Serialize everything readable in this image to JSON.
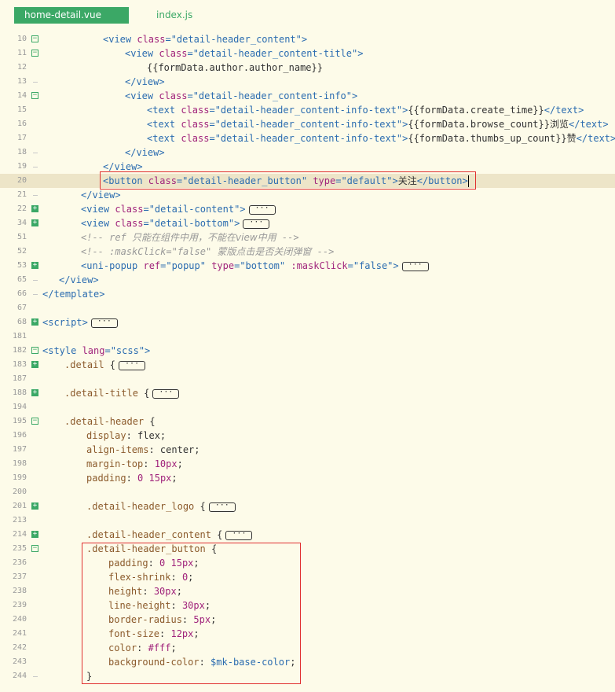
{
  "tabs": [
    {
      "label": "home-detail.vue",
      "active": true
    },
    {
      "label": "index.js",
      "active": false
    }
  ],
  "colors": {
    "accent": "#3ba866",
    "highlight_box": "#e03030",
    "background": "#fdfbe9"
  },
  "lines": [
    {
      "n": "10",
      "fold": "minus",
      "indent": 11,
      "tokens": [
        [
          "tag",
          "<view "
        ],
        [
          "attr",
          "class"
        ],
        [
          "tag",
          "=\"detail-header_content\">"
        ]
      ]
    },
    {
      "n": "11",
      "fold": "minus",
      "indent": 15,
      "tokens": [
        [
          "tag",
          "<view "
        ],
        [
          "attr",
          "class"
        ],
        [
          "tag",
          "=\"detail-header_content-title\">"
        ]
      ]
    },
    {
      "n": "12",
      "fold": "",
      "indent": 19,
      "tokens": [
        [
          "txt",
          "{{formData.author.author_name}}"
        ]
      ]
    },
    {
      "n": "13",
      "fold": "end",
      "indent": 15,
      "tokens": [
        [
          "tag",
          "</view>"
        ]
      ]
    },
    {
      "n": "14",
      "fold": "minus",
      "indent": 15,
      "tokens": [
        [
          "tag",
          "<view "
        ],
        [
          "attr",
          "class"
        ],
        [
          "tag",
          "=\"detail-header_content-info\">"
        ]
      ]
    },
    {
      "n": "15",
      "fold": "",
      "indent": 19,
      "tokens": [
        [
          "tag",
          "<text "
        ],
        [
          "attr",
          "class"
        ],
        [
          "tag",
          "=\"detail-header_content-info-text\">"
        ],
        [
          "txt",
          "{{formData.create_time}}"
        ],
        [
          "tag",
          "</text>"
        ]
      ]
    },
    {
      "n": "16",
      "fold": "",
      "indent": 19,
      "tokens": [
        [
          "tag",
          "<text "
        ],
        [
          "attr",
          "class"
        ],
        [
          "tag",
          "=\"detail-header_content-info-text\">"
        ],
        [
          "txt",
          "{{formData.browse_count}}"
        ],
        [
          "cjk",
          "浏览"
        ],
        [
          "tag",
          "</text>"
        ]
      ]
    },
    {
      "n": "17",
      "fold": "",
      "indent": 19,
      "tokens": [
        [
          "tag",
          "<text "
        ],
        [
          "attr",
          "class"
        ],
        [
          "tag",
          "=\"detail-header_content-info-text\">"
        ],
        [
          "txt",
          "{{formData.thumbs_up_count}}"
        ],
        [
          "cjk",
          "赞"
        ],
        [
          "tag",
          "</text>"
        ]
      ]
    },
    {
      "n": "18",
      "fold": "end",
      "indent": 15,
      "tokens": [
        [
          "tag",
          "</view>"
        ]
      ]
    },
    {
      "n": "19",
      "fold": "end",
      "indent": 11,
      "tokens": [
        [
          "tag",
          "</view>"
        ]
      ]
    },
    {
      "n": "20",
      "fold": "",
      "indent": 11,
      "hl": true,
      "cursor": true,
      "tokens": [
        [
          "tag",
          "<button "
        ],
        [
          "attr",
          "class"
        ],
        [
          "tag",
          "=\"detail-header_button\" "
        ],
        [
          "attr",
          "type"
        ],
        [
          "tag",
          "=\"default\">"
        ],
        [
          "cjk",
          "关注"
        ],
        [
          "tag",
          "</button>"
        ]
      ]
    },
    {
      "n": "21",
      "fold": "end",
      "indent": 7,
      "tokens": [
        [
          "tag",
          "</view>"
        ]
      ]
    },
    {
      "n": "22",
      "fold": "plus",
      "indent": 7,
      "ellip": true,
      "tokens": [
        [
          "tag",
          "<view "
        ],
        [
          "attr",
          "class"
        ],
        [
          "tag",
          "=\"detail-content\">"
        ]
      ]
    },
    {
      "n": "34",
      "fold": "plus",
      "indent": 7,
      "ellip": true,
      "tokens": [
        [
          "tag",
          "<view "
        ],
        [
          "attr",
          "class"
        ],
        [
          "tag",
          "=\"detail-bottom\">"
        ]
      ]
    },
    {
      "n": "51",
      "fold": "",
      "indent": 7,
      "tokens": [
        [
          "cm",
          "<!-- ref "
        ],
        [
          "cmcjk",
          "只能在组件中用，不能在view中用"
        ],
        [
          "cm",
          " -->"
        ]
      ]
    },
    {
      "n": "52",
      "fold": "",
      "indent": 7,
      "tokens": [
        [
          "cm",
          "<!-- :maskClick=\"false\" "
        ],
        [
          "cmcjk",
          "蒙版点击是否关闭弹窗"
        ],
        [
          "cm",
          " -->"
        ]
      ]
    },
    {
      "n": "53",
      "fold": "plus",
      "indent": 7,
      "ellip": true,
      "tokens": [
        [
          "tag",
          "<uni-popup "
        ],
        [
          "attr",
          "ref"
        ],
        [
          "tag",
          "=\"popup\" "
        ],
        [
          "attr",
          "type"
        ],
        [
          "tag",
          "=\"bottom\" "
        ],
        [
          "attr",
          ":maskClick"
        ],
        [
          "tag",
          "=\"false\">"
        ]
      ]
    },
    {
      "n": "65",
      "fold": "end",
      "indent": 3,
      "tokens": [
        [
          "tag",
          "</view>"
        ]
      ]
    },
    {
      "n": "66",
      "fold": "end",
      "indent": 0,
      "tokens": [
        [
          "tag",
          "</template>"
        ]
      ]
    },
    {
      "n": "67",
      "fold": "",
      "indent": 0,
      "tokens": []
    },
    {
      "n": "68",
      "fold": "plus",
      "indent": 0,
      "ellip": true,
      "tokens": [
        [
          "tag",
          "<script>"
        ]
      ]
    },
    {
      "n": "181",
      "fold": "",
      "indent": 0,
      "tokens": []
    },
    {
      "n": "182",
      "fold": "minus",
      "indent": 0,
      "tokens": [
        [
          "tag",
          "<style "
        ],
        [
          "attr",
          "lang"
        ],
        [
          "tag",
          "=\"scss\">"
        ]
      ]
    },
    {
      "n": "183",
      "fold": "plus",
      "indent": 4,
      "ellip": true,
      "tokens": [
        [
          "sel",
          ".detail "
        ],
        [
          "txt",
          "{"
        ]
      ]
    },
    {
      "n": "187",
      "fold": "",
      "indent": 0,
      "tokens": []
    },
    {
      "n": "188",
      "fold": "plus",
      "indent": 4,
      "ellip": true,
      "tokens": [
        [
          "sel",
          ".detail-title "
        ],
        [
          "txt",
          "{"
        ]
      ]
    },
    {
      "n": "194",
      "fold": "",
      "indent": 0,
      "tokens": []
    },
    {
      "n": "195",
      "fold": "minus",
      "indent": 4,
      "tokens": [
        [
          "sel",
          ".detail-header "
        ],
        [
          "txt",
          "{"
        ]
      ]
    },
    {
      "n": "196",
      "fold": "",
      "indent": 8,
      "tokens": [
        [
          "prop",
          "display"
        ],
        [
          "txt",
          ": flex;"
        ]
      ]
    },
    {
      "n": "197",
      "fold": "",
      "indent": 8,
      "tokens": [
        [
          "prop",
          "align-items"
        ],
        [
          "txt",
          ": center;"
        ]
      ]
    },
    {
      "n": "198",
      "fold": "",
      "indent": 8,
      "tokens": [
        [
          "prop",
          "margin-top"
        ],
        [
          "txt",
          ": "
        ],
        [
          "num",
          "10px"
        ],
        [
          "txt",
          ";"
        ]
      ]
    },
    {
      "n": "199",
      "fold": "",
      "indent": 8,
      "tokens": [
        [
          "prop",
          "padding"
        ],
        [
          "txt",
          ": "
        ],
        [
          "num",
          "0"
        ],
        [
          "txt",
          " "
        ],
        [
          "num",
          "15px"
        ],
        [
          "txt",
          ";"
        ]
      ]
    },
    {
      "n": "200",
      "fold": "",
      "indent": 0,
      "tokens": []
    },
    {
      "n": "201",
      "fold": "plus",
      "indent": 8,
      "ellip": true,
      "tokens": [
        [
          "sel",
          ".detail-header_logo "
        ],
        [
          "txt",
          "{"
        ]
      ]
    },
    {
      "n": "213",
      "fold": "",
      "indent": 0,
      "tokens": []
    },
    {
      "n": "214",
      "fold": "plus",
      "indent": 8,
      "ellip": true,
      "tokens": [
        [
          "sel",
          ".detail-header_content "
        ],
        [
          "txt",
          "{"
        ]
      ]
    },
    {
      "n": "235",
      "fold": "minus",
      "indent": 8,
      "tokens": [
        [
          "sel",
          ".detail-header_button "
        ],
        [
          "txt",
          "{"
        ]
      ]
    },
    {
      "n": "236",
      "fold": "",
      "indent": 12,
      "tokens": [
        [
          "prop",
          "padding"
        ],
        [
          "txt",
          ": "
        ],
        [
          "num",
          "0"
        ],
        [
          "txt",
          " "
        ],
        [
          "num",
          "15px"
        ],
        [
          "txt",
          ";"
        ]
      ]
    },
    {
      "n": "237",
      "fold": "",
      "indent": 12,
      "tokens": [
        [
          "prop",
          "flex-shrink"
        ],
        [
          "txt",
          ": "
        ],
        [
          "num",
          "0"
        ],
        [
          "txt",
          ";"
        ]
      ]
    },
    {
      "n": "238",
      "fold": "",
      "indent": 12,
      "tokens": [
        [
          "prop",
          "height"
        ],
        [
          "txt",
          ": "
        ],
        [
          "num",
          "30px"
        ],
        [
          "txt",
          ";"
        ]
      ]
    },
    {
      "n": "239",
      "fold": "",
      "indent": 12,
      "tokens": [
        [
          "prop",
          "line-height"
        ],
        [
          "txt",
          ": "
        ],
        [
          "num",
          "30px"
        ],
        [
          "txt",
          ";"
        ]
      ]
    },
    {
      "n": "240",
      "fold": "",
      "indent": 12,
      "tokens": [
        [
          "prop",
          "border-radius"
        ],
        [
          "txt",
          ": "
        ],
        [
          "num",
          "5px"
        ],
        [
          "txt",
          ";"
        ]
      ]
    },
    {
      "n": "241",
      "fold": "",
      "indent": 12,
      "tokens": [
        [
          "prop",
          "font-size"
        ],
        [
          "txt",
          ": "
        ],
        [
          "num",
          "12px"
        ],
        [
          "txt",
          ";"
        ]
      ]
    },
    {
      "n": "242",
      "fold": "",
      "indent": 12,
      "tokens": [
        [
          "prop",
          "color"
        ],
        [
          "txt",
          ": "
        ],
        [
          "num",
          "#fff"
        ],
        [
          "txt",
          ";"
        ]
      ]
    },
    {
      "n": "243",
      "fold": "",
      "indent": 12,
      "tokens": [
        [
          "prop",
          "background-color"
        ],
        [
          "txt",
          ": "
        ],
        [
          "var",
          "$mk-base-color"
        ],
        [
          "txt",
          ";"
        ]
      ]
    },
    {
      "n": "244",
      "fold": "end",
      "indent": 8,
      "tokens": [
        [
          "txt",
          "}"
        ]
      ]
    }
  ]
}
